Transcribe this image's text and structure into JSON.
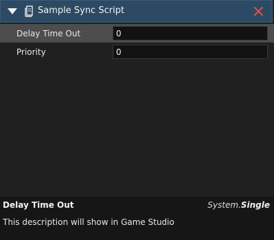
{
  "header": {
    "title": "Sample Sync Script",
    "collapse_icon": "collapse-triangle-icon",
    "script_icon": "script-file-icon",
    "close_icon": "close-icon",
    "close_color": "#e5533d"
  },
  "properties": [
    {
      "label": "Delay Time Out",
      "value": "0",
      "selected": true
    },
    {
      "label": "Priority",
      "value": "0",
      "selected": false
    }
  ],
  "description": {
    "title": "Delay Time Out",
    "type_namespace": "System.",
    "type_name": "Single",
    "text": "This description will show in Game Studio"
  }
}
